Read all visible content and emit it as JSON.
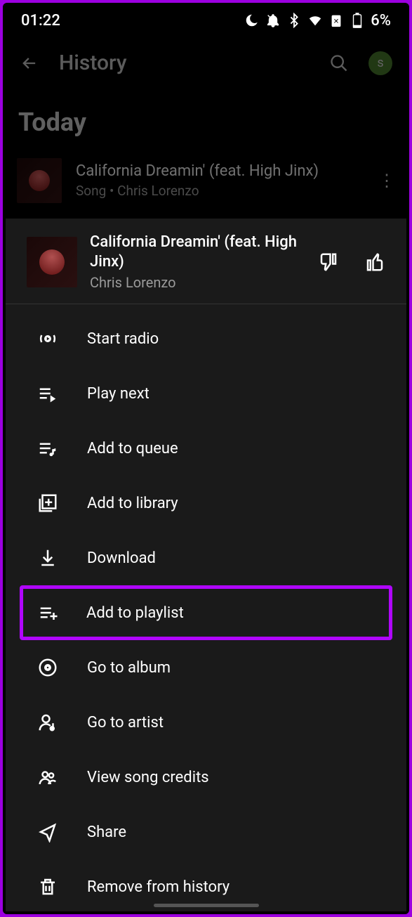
{
  "status": {
    "time": "01:22",
    "battery": "6%"
  },
  "header": {
    "title": "History"
  },
  "section": {
    "today_label": "Today"
  },
  "history_row": {
    "title": "California Dreamin' (feat. High Jinx)",
    "subtitle": "Song • Chris Lorenzo"
  },
  "sheet": {
    "title": "California Dreamin' (feat. High Jinx)",
    "artist": "Chris Lorenzo"
  },
  "menu": {
    "start_radio": "Start radio",
    "play_next": "Play next",
    "add_to_queue": "Add to queue",
    "add_to_library": "Add to library",
    "download": "Download",
    "add_to_playlist": "Add to playlist",
    "go_to_album": "Go to album",
    "go_to_artist": "Go to artist",
    "view_credits": "View song credits",
    "share": "Share",
    "remove_history": "Remove from history"
  },
  "avatar": {
    "initial": "s"
  }
}
